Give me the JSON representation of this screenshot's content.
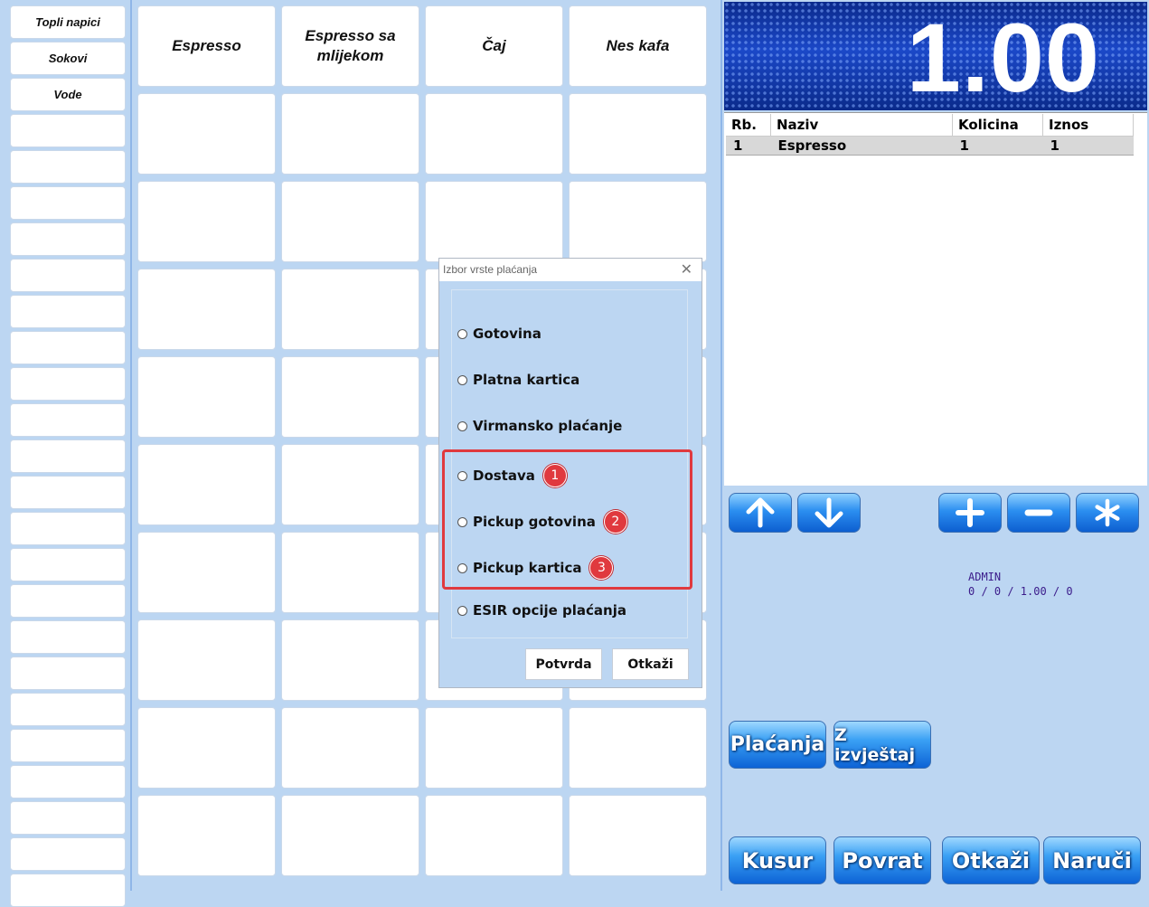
{
  "categories": [
    "Topli napici",
    "Sokovi",
    "Vode"
  ],
  "products": [
    "Espresso",
    "Espresso sa mlijekom",
    "Čaj",
    "Nes kafa"
  ],
  "display": {
    "total": "1.00"
  },
  "order": {
    "headers": [
      "Rb.",
      "Naziv",
      "Kolicina",
      "Iznos"
    ],
    "rows": [
      [
        "1",
        "Espresso",
        "1",
        "1"
      ]
    ]
  },
  "controls": {
    "up_icon": "arrow-up-icon",
    "down_icon": "arrow-down-icon",
    "plus_icon": "plus-icon",
    "minus_icon": "minus-icon",
    "star_icon": "asterisk-icon"
  },
  "status": {
    "user": "ADMIN",
    "totals": "0 / 0 / 1.00 / 0"
  },
  "actions": {
    "placanja": "Plaćanja",
    "z_izvjestaj": "Z izvještaj",
    "kusur": "Kusur",
    "povrat": "Povrat",
    "otkazi": "Otkaži",
    "naruci": "Naruči"
  },
  "dialog": {
    "title": "Izbor vrste plaćanja",
    "options": [
      {
        "label": "Gotovina"
      },
      {
        "label": "Platna kartica"
      },
      {
        "label": "Virmansko plaćanje"
      },
      {
        "label": "Dostava",
        "badge": "1"
      },
      {
        "label": "Pickup gotovina",
        "badge": "2"
      },
      {
        "label": "Pickup kartica",
        "badge": "3"
      },
      {
        "label": "ESIR opcije plaćanja"
      }
    ],
    "confirm": "Potvrda",
    "cancel": "Otkaži"
  },
  "colors": {
    "accent_blue": "#1b48c8",
    "highlight_red": "#e0393e"
  }
}
